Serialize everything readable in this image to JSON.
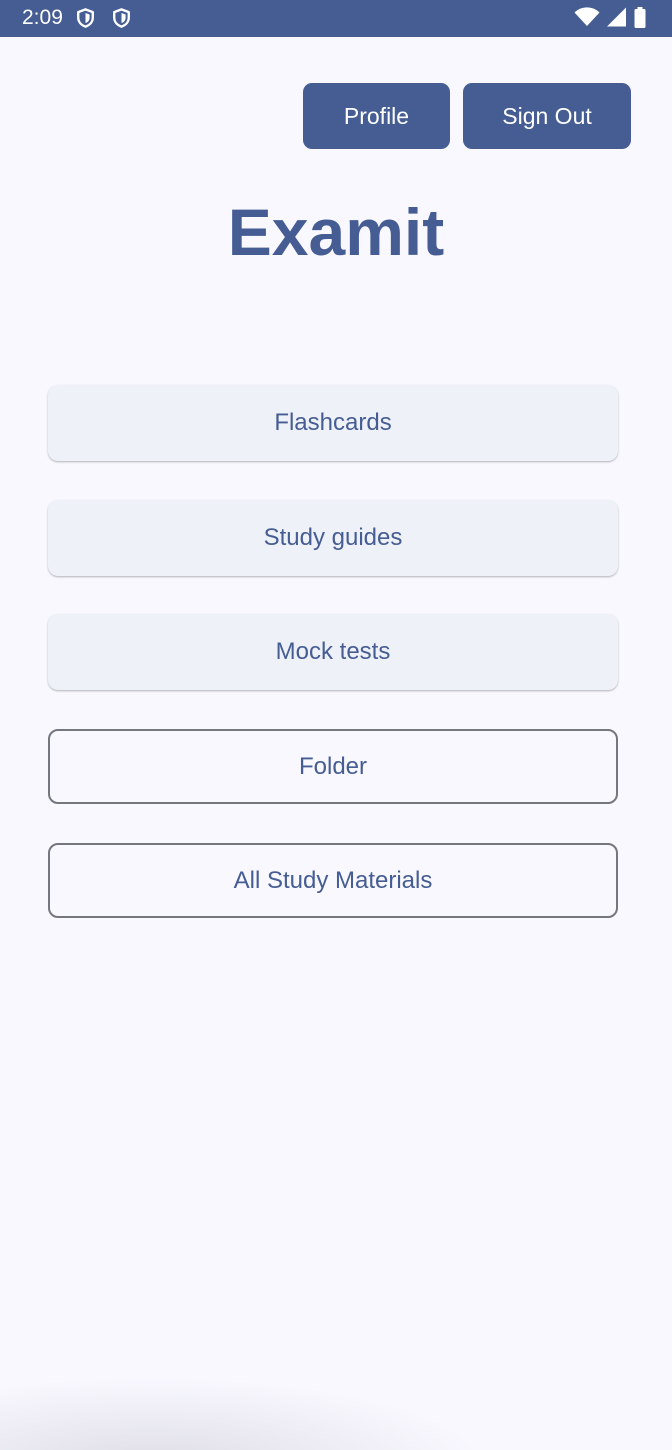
{
  "status_bar": {
    "time": "2:09",
    "icons": [
      "shield-icon",
      "shield-icon",
      "wifi-icon",
      "signal-icon",
      "battery-icon"
    ]
  },
  "header": {
    "profile_label": "Profile",
    "sign_out_label": "Sign Out"
  },
  "app": {
    "title": "Examit"
  },
  "menu": {
    "flashcards": "Flashcards",
    "study_guides": "Study guides",
    "mock_tests": "Mock tests",
    "folder": "Folder",
    "all_materials": "All Study Materials"
  },
  "colors": {
    "primary": "#455d93",
    "background": "#f9f8ff",
    "tonal_button": "#eff1f8",
    "outline": "#757780"
  }
}
